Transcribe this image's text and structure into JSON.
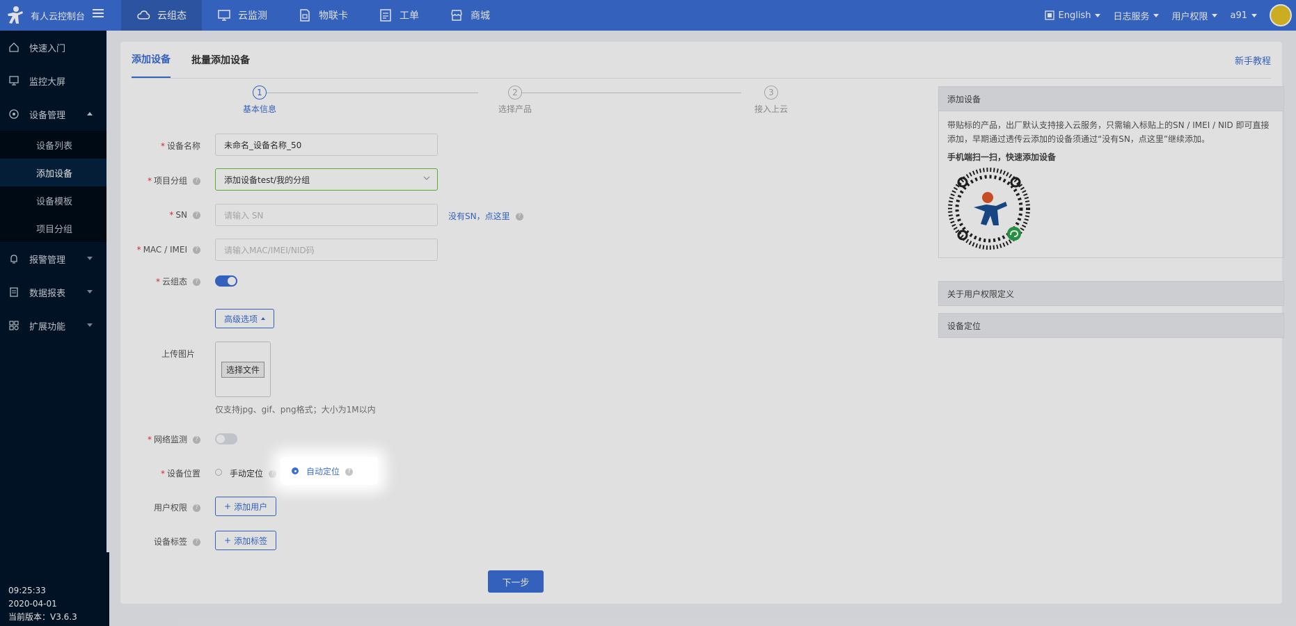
{
  "app": {
    "brand": "有人云控制台"
  },
  "top_nav": [
    {
      "label": "云组态",
      "icon": "cloud-icon",
      "active": true
    },
    {
      "label": "云监测",
      "icon": "monitor-icon",
      "active": false
    },
    {
      "label": "物联卡",
      "icon": "sim-card-icon",
      "active": false
    },
    {
      "label": "工单",
      "icon": "ticket-icon",
      "active": false
    },
    {
      "label": "商城",
      "icon": "store-icon",
      "active": false
    }
  ],
  "top_right": {
    "language": "English",
    "log_service": "日志服务",
    "user_permission": "用户权限",
    "user": "a91"
  },
  "sidebar": {
    "items": [
      {
        "label": "快速入门",
        "icon": "home-icon"
      },
      {
        "label": "监控大屏",
        "icon": "screen-icon"
      },
      {
        "label": "设备管理",
        "icon": "device-icon"
      },
      {
        "label": "报警管理",
        "icon": "bell-icon"
      },
      {
        "label": "数据报表",
        "icon": "report-icon"
      },
      {
        "label": "扩展功能",
        "icon": "apps-icon"
      }
    ],
    "sub_items": [
      "设备列表",
      "添加设备",
      "设备模板",
      "项目分组"
    ],
    "footer": {
      "time": "09:25:33",
      "date": "2020-04-01",
      "version": "当前版本：V3.6.3"
    }
  },
  "tabs": [
    "添加设备",
    "批量添加设备"
  ],
  "help_link": "新手教程",
  "steps": [
    {
      "num": "1",
      "label": "基本信息"
    },
    {
      "num": "2",
      "label": "选择产品"
    },
    {
      "num": "3",
      "label": "接入上云"
    }
  ],
  "form": {
    "device_name": {
      "label": "设备名称",
      "value": "未命名_设备名称_50"
    },
    "project_group": {
      "label": "项目分组",
      "value": "添加设备test/我的分组"
    },
    "sn": {
      "label": "SN",
      "placeholder": "请输入 SN",
      "link": "没有SN，点这里"
    },
    "mac": {
      "label": "MAC / IMEI",
      "placeholder": "请输入MAC/IMEI/NID码"
    },
    "cloud_config": {
      "label": "云组态",
      "on": true
    },
    "advanced": "高级选项",
    "upload": {
      "label": "上传图片",
      "button": "选择文件",
      "hint": "仅支持jpg、gif、png格式；大小为1M以内"
    },
    "network_monitor": {
      "label": "网络监测",
      "on": false
    },
    "location": {
      "label": "设备位置",
      "manual": "手动定位",
      "auto": "自动定位",
      "selected": "auto"
    },
    "user_permission": {
      "label": "用户权限",
      "button": "添加用户"
    },
    "device_tag": {
      "label": "设备标签",
      "button": "添加标签"
    },
    "next": "下一步"
  },
  "side_panel": {
    "add_device_title": "添加设备",
    "description": "带贴标的产品，出厂默认支持接入云服务，只需输入标贴上的SN / IMEI / NID 即可直接添加，早期通过透传云添加的设备须通过“没有SN，点这里”继续添加。",
    "scan_tip": "手机端扫一扫，快速添加设备",
    "section2": "关于用户权限定义",
    "section3": "设备定位"
  },
  "colors": {
    "primary": "#3b6fd6",
    "sidebar": "#001529",
    "required": "#e33333",
    "success": "#67c23a"
  }
}
